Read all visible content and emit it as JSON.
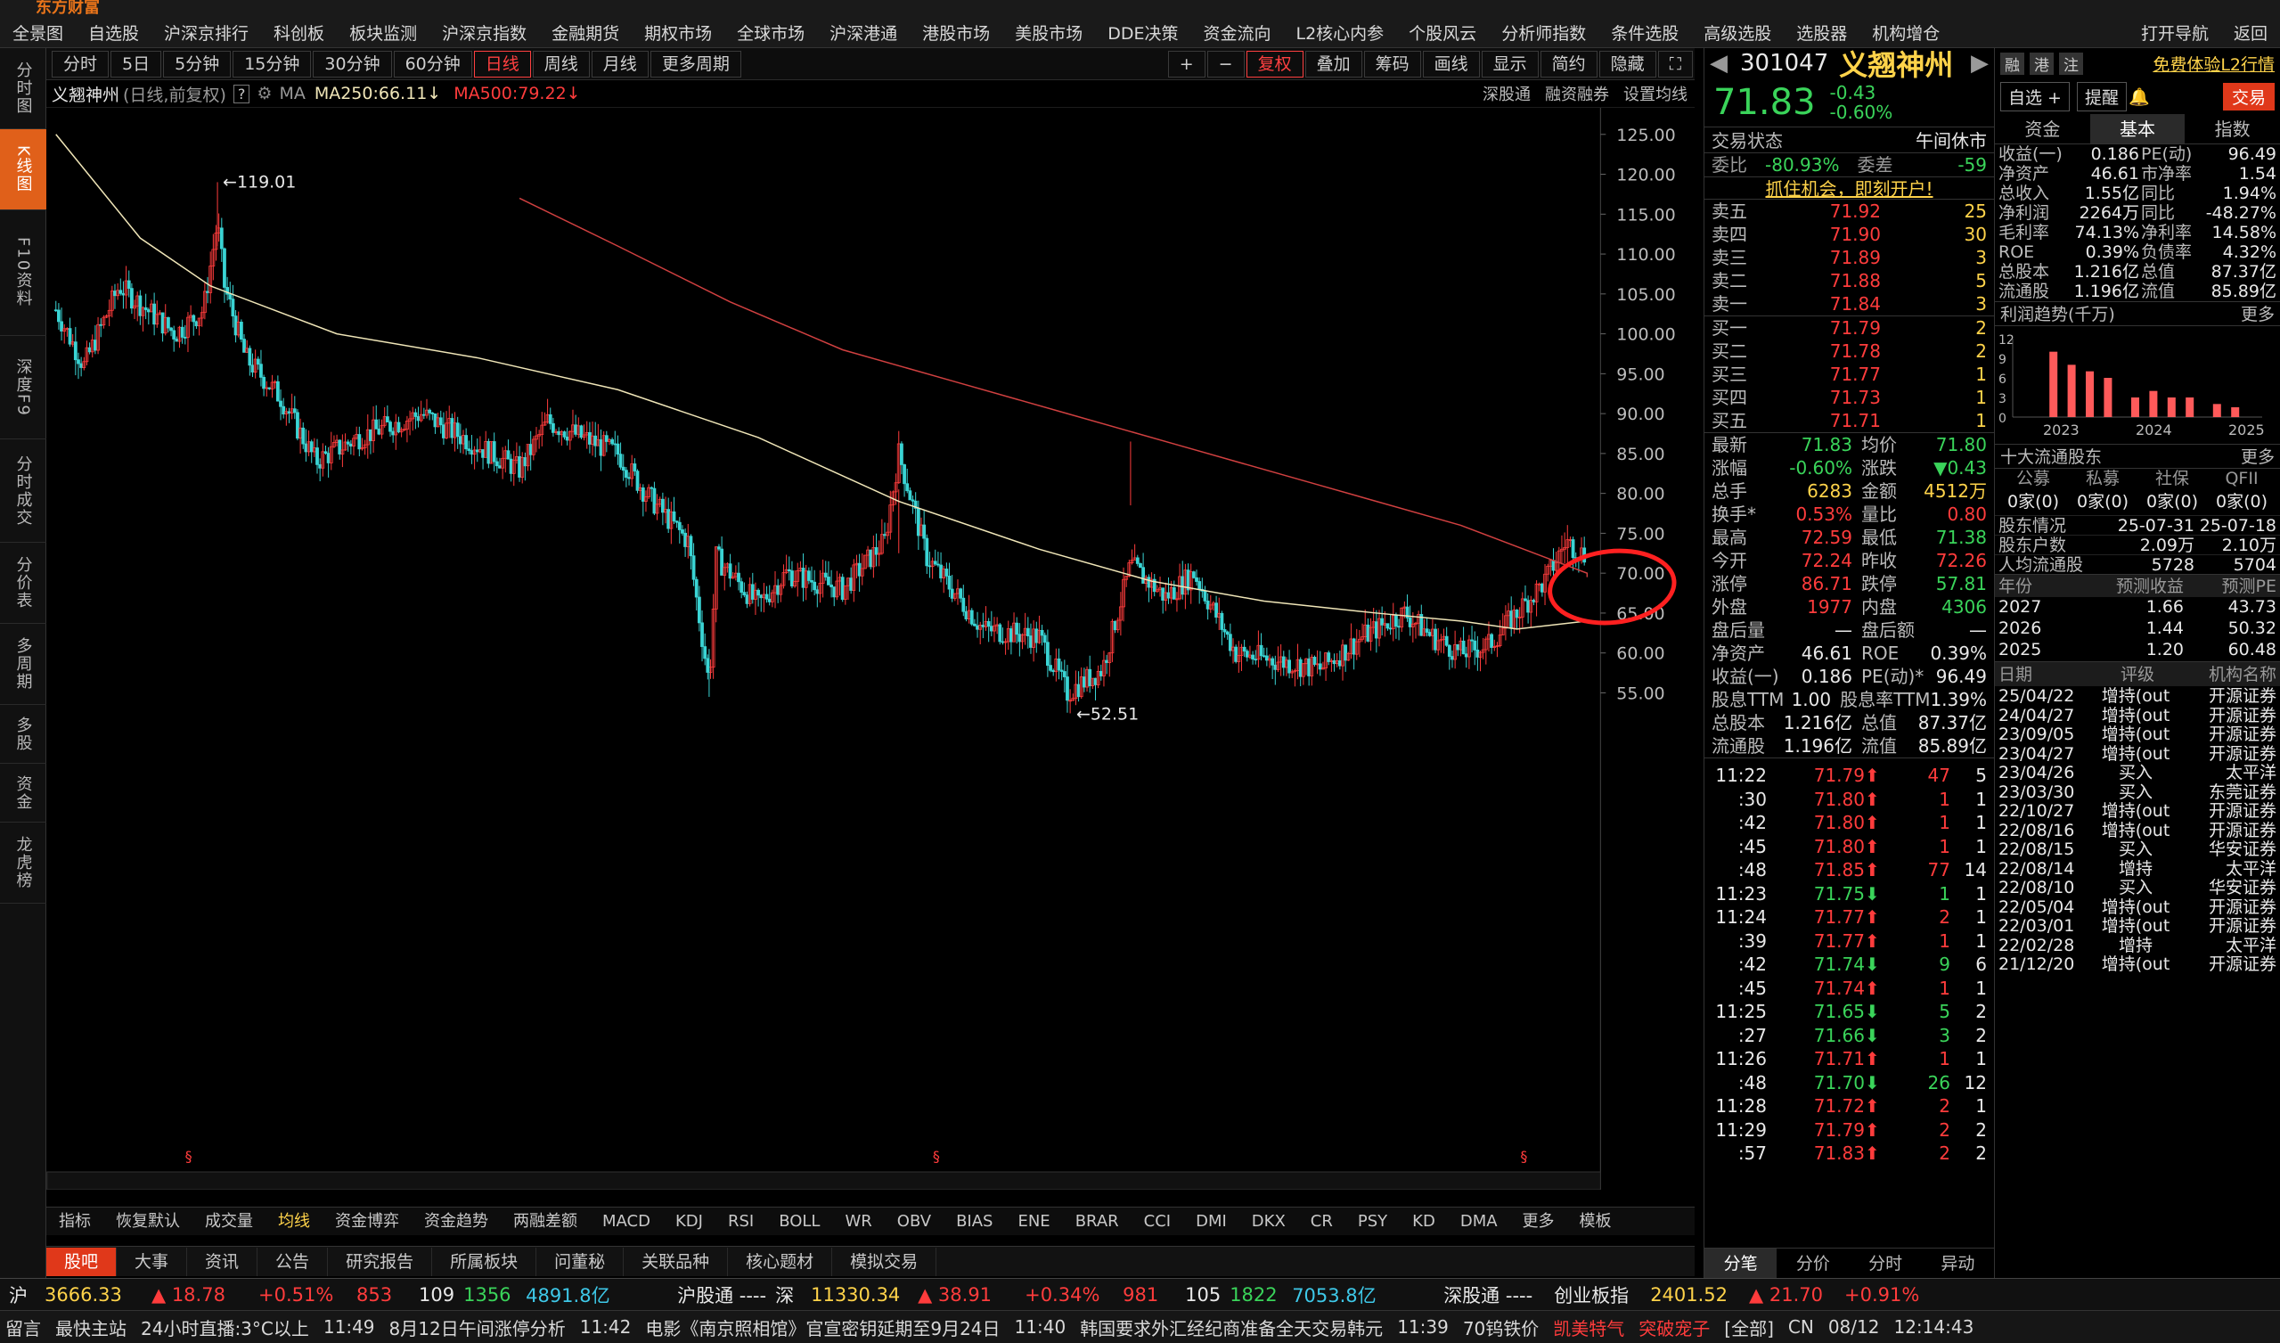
{
  "menu": [
    "全景图",
    "自选股",
    "沪深京排行",
    "科创板",
    "板块监测",
    "沪深京指数",
    "金融期货",
    "期权市场",
    "全球市场",
    "沪深港通",
    "港股市场",
    "美股市场",
    "DDE决策",
    "资金流向",
    "L2核心内参",
    "个股风云",
    "分析师指数",
    "条件选股",
    "高级选股",
    "选股器",
    "机构增仓"
  ],
  "menu_right": [
    "打开导航",
    "返回"
  ],
  "lefttabs": [
    "分时图",
    "K线图",
    "F10资料",
    "深度F9",
    "分时成交",
    "分价表",
    "多周期",
    "多股",
    "资金",
    "龙虎榜"
  ],
  "periods": [
    "分时",
    "5日",
    "5分钟",
    "15分钟",
    "30分钟",
    "60分钟",
    "日线",
    "周线",
    "月线",
    "更多周期"
  ],
  "tools": [
    "复权",
    "叠加",
    "筹码",
    "画线",
    "显示",
    "简约",
    "隐藏"
  ],
  "header": {
    "name": "义翘神州",
    "mode": "(日线,前复权)",
    "help": "?",
    "ma": "MA",
    "ma250": "MA250:66.11",
    "ma500": "MA500:79.22",
    "links": [
      "深股通",
      "融资融券",
      "设置均线"
    ]
  },
  "chart_data": {
    "type": "candlestick",
    "yaxis": [
      130.0,
      125.0,
      120.0,
      115.0,
      110.0,
      105.0,
      100.0,
      95.0,
      90.0,
      85.0,
      80.0,
      75.0,
      70.0,
      65.0,
      60.0,
      55.0
    ],
    "annotations": [
      {
        "label": "119.01"
      },
      {
        "label": "52.51"
      }
    ],
    "series": [
      {
        "name": "MA250",
        "last": 66.11
      },
      {
        "name": "MA500",
        "last": 79.22
      }
    ]
  },
  "indicators": [
    "指标",
    "恢复默认",
    "成交量",
    "均线",
    "资金博弈",
    "资金趋势",
    "两融差额",
    "MACD",
    "KDJ",
    "RSI",
    "BOLL",
    "WR",
    "OBV",
    "BIAS",
    "ENE",
    "BRAR",
    "CCI",
    "DMI",
    "DKX",
    "CR",
    "PSY",
    "KD",
    "DMA",
    "更多",
    "模板"
  ],
  "btabs": [
    "股吧",
    "大事",
    "资讯",
    "公告",
    "研究报告",
    "所属板块",
    "问董秘",
    "关联品种",
    "核心题材",
    "模拟交易"
  ],
  "stock": {
    "code": "301047",
    "name": "义翘神州",
    "price": "71.83",
    "change": "-0.43",
    "pct": "-0.60%",
    "badges": [
      "融",
      "港",
      "注"
    ],
    "l2": "免费体验L2行情",
    "btns": [
      "自选 +",
      "提醒",
      "交易"
    ]
  },
  "status": {
    "label": "交易状态",
    "value": "午间休市"
  },
  "weibi": {
    "l1": "委比",
    "v1": "-80.93%",
    "l2": "委差",
    "v2": "-59"
  },
  "promo": "抓住机会，即刻开户!",
  "sells": [
    [
      "卖五",
      "71.92",
      "25"
    ],
    [
      "卖四",
      "71.90",
      "30"
    ],
    [
      "卖三",
      "71.89",
      "3"
    ],
    [
      "卖二",
      "71.88",
      "5"
    ],
    [
      "卖一",
      "71.84",
      "3"
    ]
  ],
  "buys": [
    [
      "买一",
      "71.79",
      "2"
    ],
    [
      "买二",
      "71.78",
      "2"
    ],
    [
      "买三",
      "71.77",
      "1"
    ],
    [
      "买四",
      "71.73",
      "1"
    ],
    [
      "买五",
      "71.71",
      "1"
    ]
  ],
  "stats": [
    [
      "最新",
      "71.83",
      "均价",
      "71.80"
    ],
    [
      "涨幅",
      "-0.60%",
      "涨跌",
      "▼0.43"
    ],
    [
      "总手",
      "6283",
      "金额",
      "4512万"
    ],
    [
      "换手*",
      "0.53%",
      "量比",
      "0.80"
    ],
    [
      "最高",
      "72.59",
      "最低",
      "71.38"
    ],
    [
      "今开",
      "72.24",
      "昨收",
      "72.26"
    ],
    [
      "涨停",
      "86.71",
      "跌停",
      "57.81"
    ],
    [
      "外盘",
      "1977",
      "内盘",
      "4306"
    ],
    [
      "盘后量",
      "—",
      "盘后额",
      "—"
    ],
    [
      "净资产",
      "46.61",
      "ROE",
      "0.39%"
    ],
    [
      "收益(一)",
      "0.186",
      "PE(动)*",
      "96.49"
    ],
    [
      "股息TTM",
      "1.00",
      "股息率TTM",
      "1.39%"
    ],
    [
      "总股本",
      "1.216亿",
      "总值",
      "87.37亿"
    ],
    [
      "流通股",
      "1.196亿",
      "流值",
      "85.89亿"
    ]
  ],
  "ticks": [
    [
      "11:22",
      "71.79",
      "47",
      "5"
    ],
    [
      ":30",
      "71.80",
      "1",
      "1"
    ],
    [
      ":42",
      "71.80",
      "1",
      "1"
    ],
    [
      ":45",
      "71.80",
      "1",
      "1"
    ],
    [
      ":48",
      "71.85",
      "77",
      "14"
    ],
    [
      "11:23",
      "71.75",
      "1",
      "1"
    ],
    [
      "11:24",
      "71.77",
      "2",
      "1"
    ],
    [
      ":39",
      "71.77",
      "1",
      "1"
    ],
    [
      ":42",
      "71.74",
      "9",
      "6"
    ],
    [
      ":45",
      "71.74",
      "1",
      "1"
    ],
    [
      "11:25",
      "71.65",
      "5",
      "2"
    ],
    [
      ":27",
      "71.66",
      "3",
      "2"
    ],
    [
      "11:26",
      "71.71",
      "1",
      "1"
    ],
    [
      ":48",
      "71.70",
      "26",
      "12"
    ],
    [
      "11:28",
      "71.72",
      "2",
      "1"
    ],
    [
      "11:29",
      "71.79",
      "2",
      "2"
    ],
    [
      ":57",
      "71.83",
      "2",
      "2"
    ]
  ],
  "qtabs": [
    "分笔",
    "分价",
    "分时",
    "异动"
  ],
  "infotabs": [
    "资金",
    "基本",
    "指数"
  ],
  "basic": [
    [
      "收益(一)",
      "0.186",
      "PE(动)",
      "96.49"
    ],
    [
      "净资产",
      "46.61",
      "市净率",
      "1.54"
    ],
    [
      "总收入",
      "1.55亿",
      "同比",
      "1.94%"
    ],
    [
      "净利润",
      "2264万",
      "同比",
      "-48.27%"
    ],
    [
      "毛利率",
      "74.13%",
      "净利率",
      "14.58%"
    ],
    [
      "ROE",
      "0.39%",
      "负债率",
      "4.32%"
    ],
    [
      "总股本",
      "1.216亿",
      "总值",
      "87.37亿"
    ],
    [
      "流通股",
      "1.196亿",
      "流值",
      "85.89亿"
    ]
  ],
  "profit": {
    "title": "利润趋势(千万)",
    "more": "更多",
    "yticks": [
      "12",
      "9",
      "6",
      "3",
      "0"
    ],
    "years": [
      "2023",
      "2024",
      "2025"
    ],
    "bars": [
      10,
      8,
      7,
      6,
      3,
      4,
      3,
      3,
      2,
      1.5
    ]
  },
  "holders": {
    "title": "十大流通股东",
    "more": "更多",
    "cats": [
      "公募",
      "私募",
      "社保",
      "QFII"
    ],
    "vals": [
      "0家(0)",
      "0家(0)",
      "0家(0)",
      "0家(0)"
    ],
    "rows": [
      [
        "股东情况",
        "25-07-31",
        "25-07-18"
      ],
      [
        "股东户数",
        "2.09万",
        "2.10万"
      ],
      [
        "人均流通股",
        "5728",
        "5704"
      ]
    ]
  },
  "forecast": {
    "hdr": [
      "年份",
      "预测收益",
      "预测PE"
    ],
    "rows": [
      [
        "2027",
        "1.66",
        "43.73"
      ],
      [
        "2026",
        "1.44",
        "50.32"
      ],
      [
        "2025",
        "1.20",
        "60.48"
      ]
    ]
  },
  "ratings": {
    "hdr": [
      "日期",
      "评级",
      "机构名称"
    ],
    "rows": [
      [
        "25/04/22",
        "增持(out",
        "开源证券"
      ],
      [
        "24/04/27",
        "增持(out",
        "开源证券"
      ],
      [
        "23/09/05",
        "增持(out",
        "开源证券"
      ],
      [
        "23/04/27",
        "增持(out",
        "开源证券"
      ],
      [
        "23/04/26",
        "买入",
        "太平洋"
      ],
      [
        "23/03/30",
        "买入",
        "东莞证券"
      ],
      [
        "22/10/27",
        "增持(out",
        "开源证券"
      ],
      [
        "22/08/16",
        "增持(out",
        "开源证券"
      ],
      [
        "22/08/15",
        "买入",
        "华安证券"
      ],
      [
        "22/08/14",
        "增持",
        "太平洋"
      ],
      [
        "22/08/10",
        "买入",
        "华安证券"
      ],
      [
        "22/05/04",
        "增持(out",
        "开源证券"
      ],
      [
        "22/03/01",
        "增持(out",
        "开源证券"
      ],
      [
        "22/02/28",
        "增持",
        "太平洋"
      ],
      [
        "21/12/20",
        "增持(out",
        "开源证券"
      ]
    ]
  },
  "index": {
    "sh": [
      "沪",
      "3666.33",
      "▲ 18.78",
      "+0.51%",
      "853",
      "109",
      "1356",
      "4891.8亿"
    ],
    "hgt": "沪股通 ----",
    "sz": [
      "深",
      "11330.34",
      "▲ 38.91",
      "+0.34%",
      "981",
      "105",
      "1822",
      "7053.8亿"
    ],
    "sgt": "深股通 ----",
    "cy": [
      "创业板指",
      "2401.52",
      "▲ 21.70",
      "+0.91%"
    ]
  },
  "news": [
    "留言",
    "最快主站",
    "24小时直播:3°C以上",
    "11:49",
    "8月12日午间涨停分析",
    "11:42",
    "电影《南京照相馆》官宣密钥延期至9月24日",
    "11:40",
    "韩国要求外汇经纪商准备全天交易韩元",
    "11:39",
    "70钨铁价",
    "凯美特气",
    "突破宠子",
    "[全部]",
    "CN",
    "08/12",
    "12:14:43"
  ]
}
